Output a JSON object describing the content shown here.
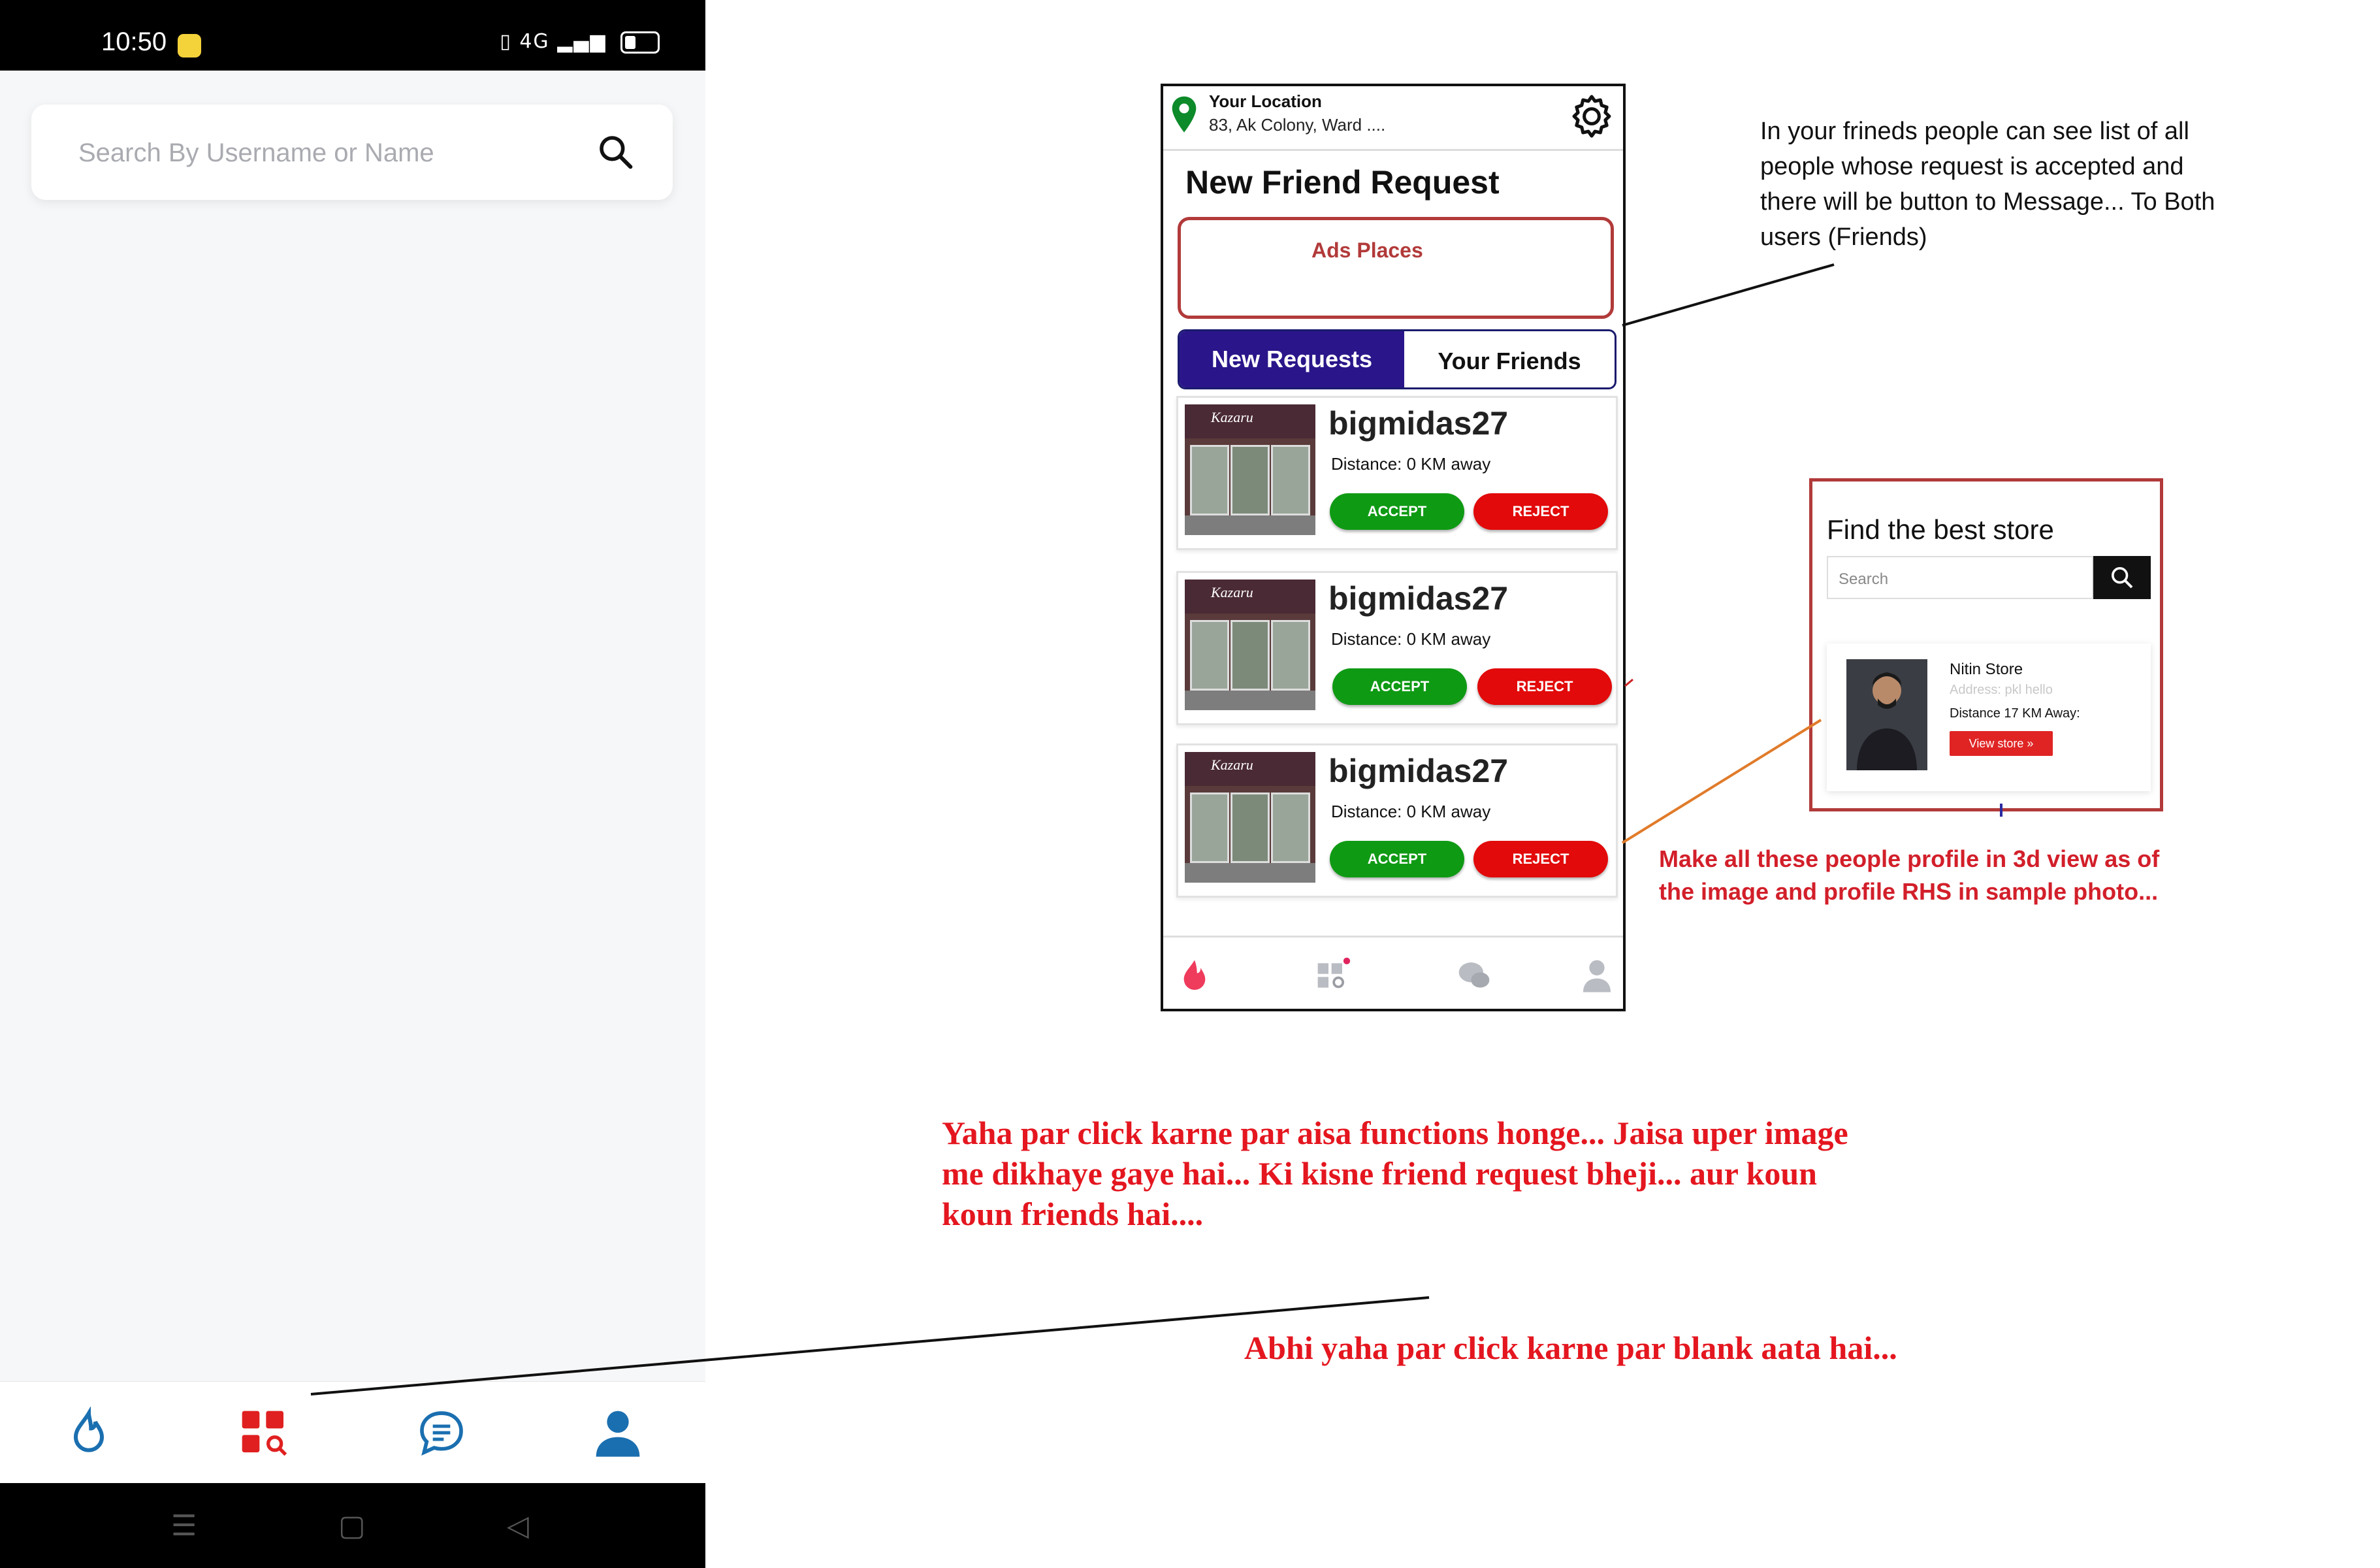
{
  "status_bar": {
    "time": "10:50",
    "network": "4G"
  },
  "left_screen": {
    "search": {
      "placeholder": "Search By Username or Name"
    },
    "bottom_nav": [
      {
        "name": "feed",
        "icon": "flame-icon",
        "color": "#1a6fb0"
      },
      {
        "name": "discover",
        "icon": "grid-search-icon",
        "color": "#e02020",
        "active": true
      },
      {
        "name": "messages",
        "icon": "chat-icon",
        "color": "#1a6fb0"
      },
      {
        "name": "profile",
        "icon": "user-icon",
        "color": "#1a6fb0"
      }
    ],
    "system_nav": [
      "menu",
      "home",
      "back"
    ]
  },
  "mockup": {
    "location_title": "Your Location",
    "location_address": "83, Ak Colony, Ward ....",
    "page_title": "New Friend Request",
    "ads_label": "Ads Places",
    "tabs": {
      "new_requests": "New Requests",
      "your_friends": "Your Friends"
    },
    "thumb_sign": "Kazaru",
    "requests": [
      {
        "username": "bigmidas27",
        "distance": "Distance: 0 KM away",
        "accept": "ACCEPT",
        "reject": "REJECT"
      },
      {
        "username": "bigmidas27",
        "distance": "Distance: 0 KM away",
        "accept": "ACCEPT",
        "reject": "REJECT"
      },
      {
        "username": "bigmidas27",
        "distance": "Distance: 0 KM away",
        "accept": "ACCEPT",
        "reject": "REJECT"
      }
    ]
  },
  "store_sample": {
    "title": "Find the best store",
    "search_placeholder": "Search",
    "store_name": "Nitin Store",
    "address": "Address: pkl hello",
    "distance": "Distance 17 KM Away:",
    "view_button": "View store »"
  },
  "annotations": {
    "friends_note": "In your frineds people can see list of all people whose request is accepted and there will be button to Message... To Both users (Friends)",
    "profile_note": "Make all these people profile in 3d view as of the image and profile RHS in sample photo...",
    "function_note": "Yaha par click karne par aisa functions honge... Jaisa uper image me dikhaye gaye hai... Ki kisne friend request bheji... aur koun koun friends hai....",
    "blank_note": "Abhi yaha par click karne par blank aata hai..."
  },
  "colors": {
    "accent_blue": "#1a6fb0",
    "tab_active": "#2a168a",
    "accept_green": "#0f9a14",
    "reject_red": "#e20a0a",
    "annotation_red": "#e4161f",
    "border_red": "#b23a3a"
  }
}
